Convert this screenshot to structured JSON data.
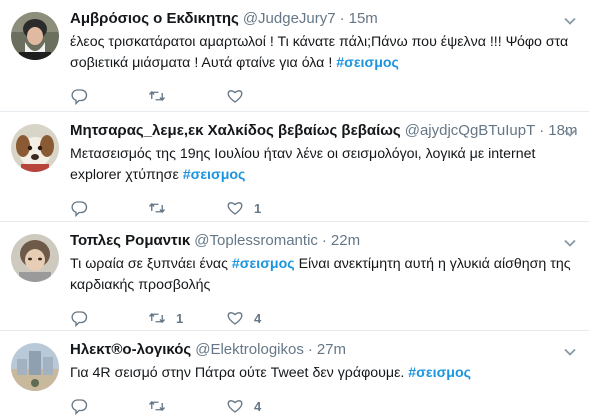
{
  "tweets": [
    {
      "name": "Αμβρόσιος ο Εκδικητης",
      "handle": "@JudgeJury7",
      "time": "15m",
      "text": "έλεος τρισκατάρατοι αμαρτωλοί ! Τι κάνατε πάλι;Πάνω που έψελνα !!! Ψόφο στα σοβιετικά μιάσματα ! Αυτά φταίνε για όλα ! ",
      "hashtag": "#σεισμος",
      "text_after": "",
      "retweets": "",
      "likes": ""
    },
    {
      "name": "Μητσαρας_λεμε,εκ Χαλκίδος βεβαίως βεβαίως",
      "handle": "@ajydjcQgBTuIupT",
      "time": "18m",
      "text": "Μετασεισμός της 19ης Ιουλίου ήταν λένε οι σεισμολόγοι, λογικά με internet explorer χτύπησε ",
      "hashtag": "#σεισμος",
      "text_after": "",
      "retweets": "",
      "likes": "1"
    },
    {
      "name": "Τοπλες Ρομαντικ",
      "handle": "@Toplessromantic",
      "time": "22m",
      "text": "Τι ωραία σε ξυπνάει ένας ",
      "hashtag": "#σεισμος",
      "text_after": " Είναι ανεκτίμητη αυτή η γλυκιά αίσθηση της καρδιακής προσβολής",
      "retweets": "1",
      "likes": "4"
    },
    {
      "name": "Ηλεκτ®ο-λογικός",
      "handle": "@Elektrologikos",
      "time": "27m",
      "text": "Για 4R σεισμό στην Πάτρα ούτε  Tweet δεν γράφουμε. ",
      "hashtag": "#σεισμος",
      "text_after": "",
      "retweets": "",
      "likes": "4"
    }
  ],
  "separator": "·",
  "icons": {
    "reply": "reply-icon",
    "retweet": "retweet-icon",
    "like": "heart-icon",
    "more": "chevron-down-icon"
  },
  "colors": {
    "hashtag": "#1b95e0",
    "secondary_text": "#657786",
    "divider": "#e6ecf0"
  }
}
